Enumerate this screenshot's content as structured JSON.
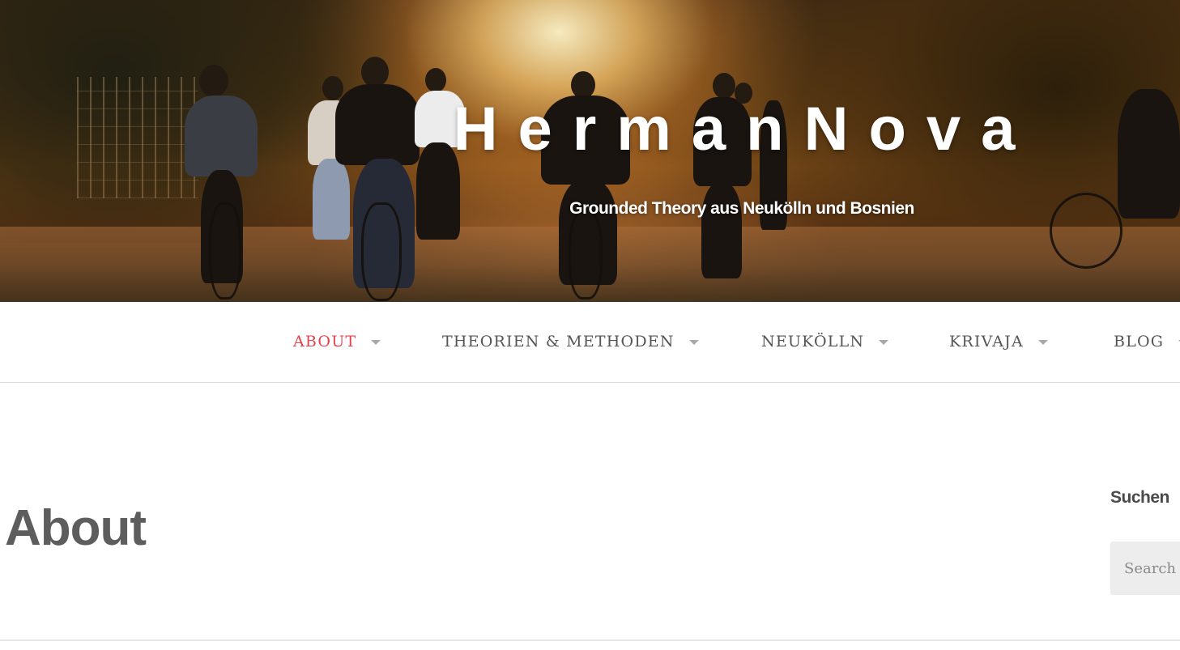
{
  "site": {
    "title": "HermanNova",
    "tagline": "Grounded Theory aus Neukölln und Bosnien"
  },
  "nav": {
    "items": [
      {
        "label": "ABOUT",
        "active": true,
        "has_dropdown": true
      },
      {
        "label": "THEORIEN & METHODEN",
        "active": false,
        "has_dropdown": true
      },
      {
        "label": "NEUKÖLLN",
        "active": false,
        "has_dropdown": true
      },
      {
        "label": "KRIVAJA",
        "active": false,
        "has_dropdown": true
      },
      {
        "label": "BLOG",
        "active": false,
        "has_dropdown": true
      }
    ],
    "active_color": "#e2424c",
    "text_color": "#555555"
  },
  "main": {
    "page_title": "About"
  },
  "sidebar": {
    "search_widget_title": "Suchen",
    "search_placeholder": "Search",
    "search_value": ""
  },
  "icons": {
    "dropdown": "caret-down-icon"
  }
}
